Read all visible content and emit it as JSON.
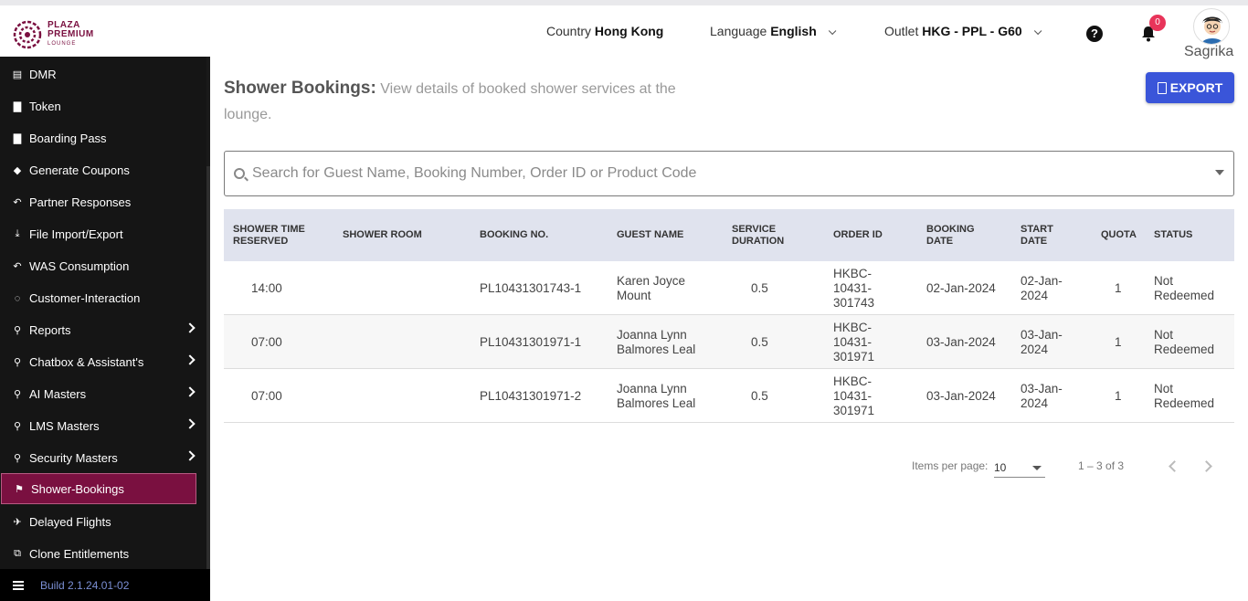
{
  "brand": {
    "line1": "PLAZA",
    "line2": "PREMIUM",
    "line3": "LOUNGE",
    "color": "#7a1040"
  },
  "header": {
    "country_label": "Country",
    "country_value": "Hong Kong",
    "language_label": "Language",
    "language_value": "English",
    "outlet_label": "Outlet",
    "outlet_value": "HKG - PPL - G60",
    "help_icon": "question-circle-icon",
    "notifications_icon": "bell-icon",
    "notifications_count": "0",
    "user_name": "Sagrika"
  },
  "sidebar": {
    "items": [
      {
        "label": "DMR",
        "icon": "calendar-icon",
        "glyph": "▤"
      },
      {
        "label": "Token",
        "icon": "document-icon",
        "glyph": "▇"
      },
      {
        "label": "Boarding Pass",
        "icon": "document-icon",
        "glyph": "▇"
      },
      {
        "label": "Generate Coupons",
        "icon": "tags-icon",
        "glyph": "◆"
      },
      {
        "label": "Partner Responses",
        "icon": "reply-icon",
        "glyph": "↶"
      },
      {
        "label": "File Import/Export",
        "icon": "download-icon",
        "glyph": "⤓"
      },
      {
        "label": "WAS Consumption",
        "icon": "reply-icon",
        "glyph": "↶"
      },
      {
        "label": "Customer-Interaction",
        "icon": "chat-icon",
        "glyph": "◌"
      },
      {
        "label": "Reports",
        "icon": "sitemap-icon",
        "glyph": "⚲",
        "expandable": true
      },
      {
        "label": "Chatbox & Assistant's",
        "icon": "sitemap-icon",
        "glyph": "⚲",
        "expandable": true
      },
      {
        "label": "AI Masters",
        "icon": "sitemap-icon",
        "glyph": "⚲",
        "expandable": true
      },
      {
        "label": "LMS Masters",
        "icon": "sitemap-icon",
        "glyph": "⚲",
        "expandable": true
      },
      {
        "label": "Security Masters",
        "icon": "sitemap-icon",
        "glyph": "⚲",
        "expandable": true
      },
      {
        "label": "Shower-Bookings",
        "icon": "shower-icon",
        "glyph": "⚑",
        "active": true
      },
      {
        "label": "Delayed Flights",
        "icon": "plane-icon",
        "glyph": "✈"
      },
      {
        "label": "Clone Entitlements",
        "icon": "clone-icon",
        "glyph": "⧉"
      }
    ],
    "build": "Build 2.1.24.01-02"
  },
  "main": {
    "title": "Shower Bookings:",
    "subtitle": "View details of booked shower services at the lounge.",
    "export_label": "EXPORT",
    "search_placeholder": "Search for Guest Name, Booking Number, Order ID or Product Code",
    "table": {
      "headers": {
        "time": "SHOWER TIME RESERVED",
        "room": "SHOWER ROOM",
        "booking": "BOOKING NO.",
        "guest": "GUEST NAME",
        "duration": "SERVICE DURATION",
        "order": "ORDER ID",
        "bdate": "BOOKING DATE",
        "sdate": "START DATE",
        "quota": "QUOTA",
        "status": "STATUS"
      },
      "rows": [
        {
          "time": "14:00",
          "room": "",
          "booking": "PL10431301743-1",
          "guest": "Karen Joyce Mount",
          "duration": "0.5",
          "order": "HKBC-10431-301743",
          "bdate": "02-Jan-2024",
          "sdate": "02-Jan-2024",
          "quota": "1",
          "status": "Not Redeemed"
        },
        {
          "time": "07:00",
          "room": "",
          "booking": "PL10431301971-1",
          "guest": "Joanna Lynn Balmores Leal",
          "duration": "0.5",
          "order": "HKBC-10431-301971",
          "bdate": "03-Jan-2024",
          "sdate": "03-Jan-2024",
          "quota": "1",
          "status": "Not Redeemed"
        },
        {
          "time": "07:00",
          "room": "",
          "booking": "PL10431301971-2",
          "guest": "Joanna Lynn Balmores Leal",
          "duration": "0.5",
          "order": "HKBC-10431-301971",
          "bdate": "03-Jan-2024",
          "sdate": "03-Jan-2024",
          "quota": "1",
          "status": "Not Redeemed"
        }
      ]
    },
    "pagination": {
      "items_per_page_label": "Items per page:",
      "items_per_page_value": "10",
      "range": "1 – 3 of 3"
    }
  },
  "colors": {
    "accent": "#3a55d9",
    "sidebar_active": "#7a1040",
    "sidebar_bg": "#151515",
    "badge": "#e8345a"
  }
}
